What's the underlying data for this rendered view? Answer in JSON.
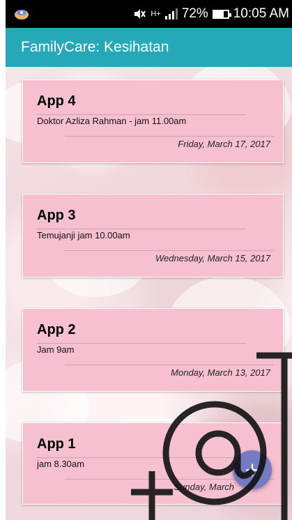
{
  "status_bar": {
    "signal_text": "H+",
    "battery": "72%",
    "battery_level": 0.72,
    "time": "10:05 AM",
    "icons": [
      "app-notification-icon",
      "mute-icon",
      "signal-icon",
      "battery-icon"
    ]
  },
  "app_bar": {
    "title": "FamilyCare: Kesihatan",
    "color": "#25a9b8"
  },
  "appointments": [
    {
      "title": "App 4",
      "description": "Doktor Azliza Rahman - jam 11.00am",
      "date": "Friday, March 17, 2017"
    },
    {
      "title": "App 3",
      "description": "Temujanji jam 10.00am",
      "date": "Wednesday, March 15, 2017"
    },
    {
      "title": "App 2",
      "description": "Jam 9am",
      "date": "Monday, March 13, 2017"
    },
    {
      "title": "App 1",
      "description": "jam 8.30am",
      "date": "Sunday, March"
    }
  ],
  "fab": {
    "icon": "plus-icon",
    "label": "+"
  },
  "colors": {
    "card": "#f7c0d0",
    "fab": "#5f6ebe"
  }
}
